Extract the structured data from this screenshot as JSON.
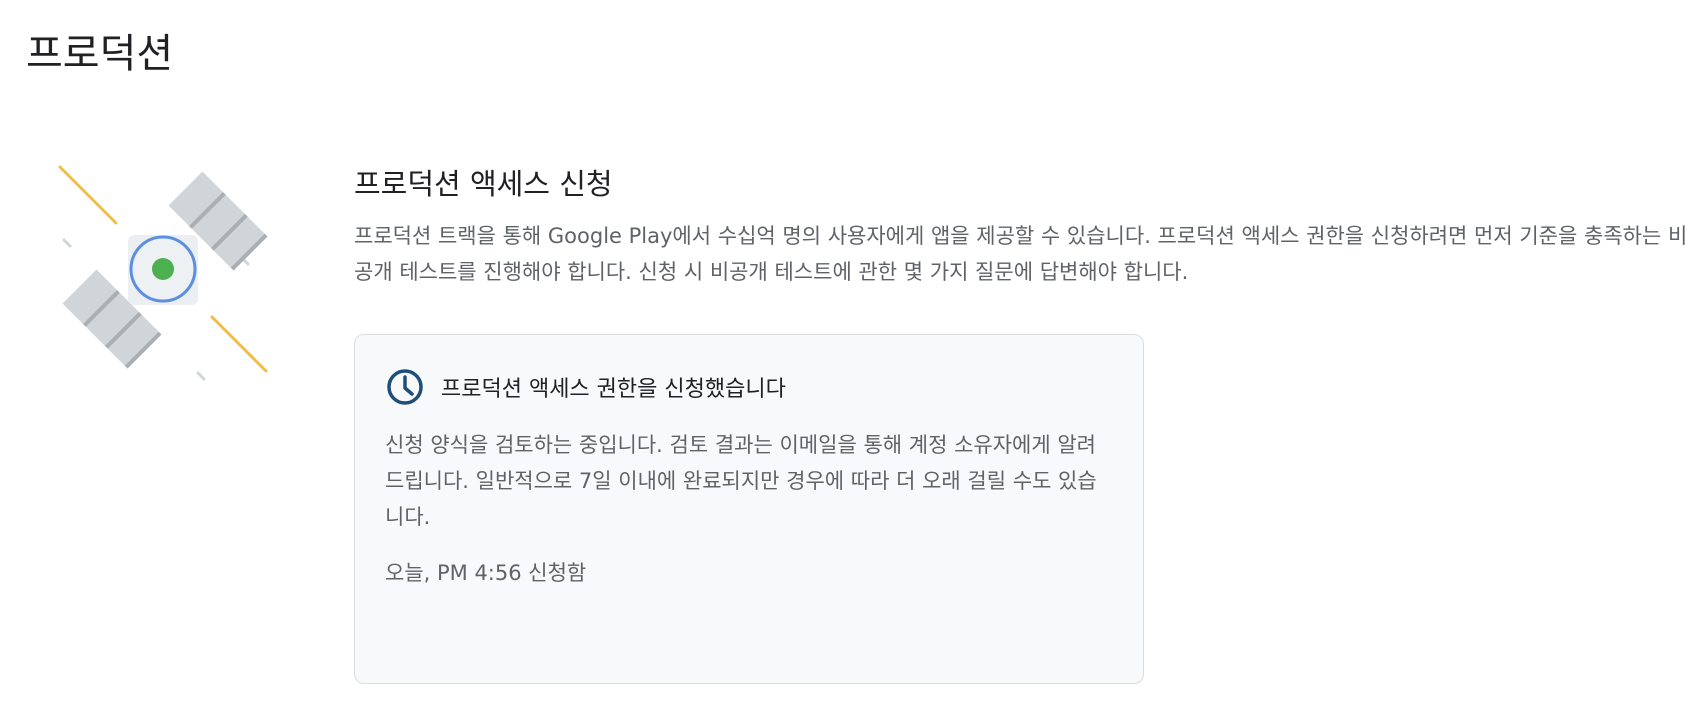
{
  "page": {
    "title": "프로덕션"
  },
  "illustration": {
    "icon": "satellite-illustration",
    "colors": {
      "panel": "#cfd5d9",
      "panel_shadow": "#9aa0a6",
      "ring": "#5d8fe0",
      "core": "#4caf50",
      "ray": "#f1bc47"
    }
  },
  "access_request": {
    "title": "프로덕션 액세스 신청",
    "description": "프로덕션 트랙을 통해 Google Play에서 수십억 명의 사용자에게 앱을 제공할 수 있습니다. 프로덕션 액세스 권한을 신청하려면 먼저 기준을 충족하는 비공개 테스트를 진행해야 합니다. 신청 시 비공개 테스트에 관한 몇 가지 질문에 답변해야 합니다."
  },
  "status_card": {
    "icon": "clock-icon",
    "icon_color": "#1f4e79",
    "title": "프로덕션 액세스 권한을 신청했습니다",
    "body": "신청 양식을 검토하는 중입니다. 검토 결과는 이메일을 통해 계정 소유자에게 알려드립니다. 일반적으로 7일 이내에 완료되지만 경우에 따라 더 오래 걸릴 수도 있습니다.",
    "submitted_at": "오늘, PM 4:56 신청함"
  }
}
